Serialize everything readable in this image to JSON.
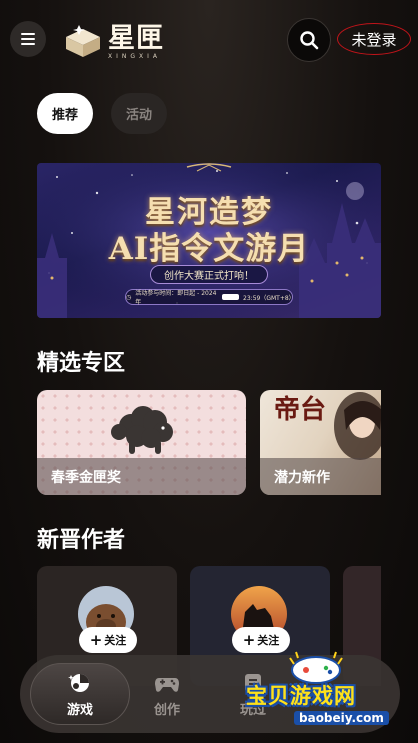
{
  "header": {
    "logo_cn": "星匣",
    "logo_en": "XINGXIA",
    "login_label": "未登录"
  },
  "tabs": [
    {
      "label": "推荐",
      "active": true
    },
    {
      "label": "活动",
      "active": false
    }
  ],
  "banner": {
    "title_line1": "星河造梦",
    "title_line2": "AI指令文游月",
    "pill_text": "创作大赛正式打响！",
    "date_text_left": "活动参与时间：即日起 - 2024年",
    "date_text_right": "23:59（GMT+8）"
  },
  "sections": {
    "featured_title": "精选专区",
    "authors_title": "新晋作者"
  },
  "featured_cards": [
    {
      "label": "春季金匣奖"
    },
    {
      "label": "潜力新作",
      "art_text": "帝台"
    }
  ],
  "authors": [
    {
      "follow_label": "关注"
    },
    {
      "follow_label": "关注"
    }
  ],
  "bottom_nav": [
    {
      "label": "游戏",
      "icon": "game-ball-icon",
      "active": true
    },
    {
      "label": "创作",
      "icon": "gamepad-icon",
      "active": false
    },
    {
      "label": "玩过",
      "icon": "history-icon",
      "active": false
    }
  ],
  "watermark": {
    "cn": "宝贝游戏网",
    "en": "baobeiy.com"
  },
  "colors": {
    "background": "#0d0b0a",
    "login_outline": "#c0141a",
    "tab_active_bg": "#ffffff",
    "tab_inactive_bg": "#2a2624",
    "nav_bg": "#3a3432"
  }
}
